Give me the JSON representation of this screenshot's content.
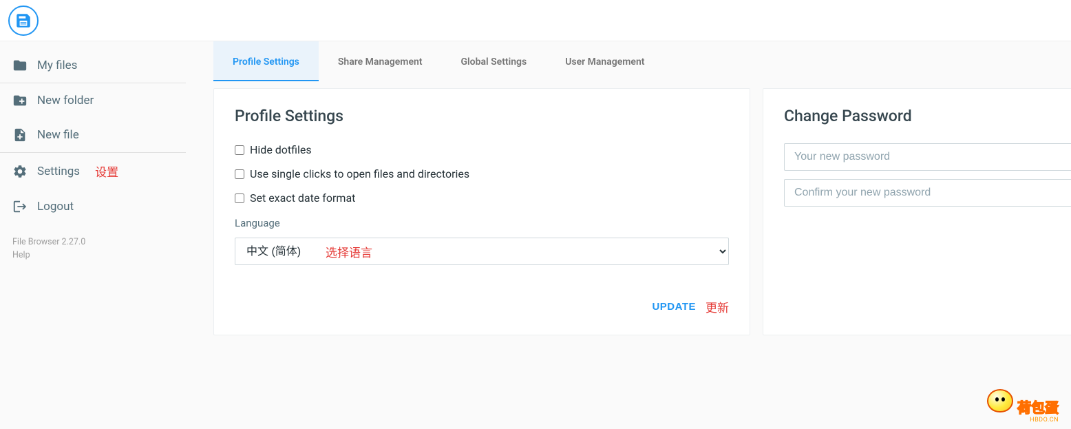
{
  "sidebar": {
    "items": [
      {
        "label": "My files"
      },
      {
        "label": "New folder"
      },
      {
        "label": "New file"
      },
      {
        "label": "Settings",
        "annotation": "设置"
      },
      {
        "label": "Logout"
      }
    ],
    "footer_version": "File Browser 2.27.0",
    "footer_help": "Help"
  },
  "tabs": [
    {
      "label": "Profile Settings",
      "active": true
    },
    {
      "label": "Share Management",
      "active": false
    },
    {
      "label": "Global Settings",
      "active": false
    },
    {
      "label": "User Management",
      "active": false
    }
  ],
  "profile": {
    "title": "Profile Settings",
    "check_hide_dotfiles": "Hide dotfiles",
    "check_single_click": "Use single clicks to open files and directories",
    "check_exact_date": "Set exact date format",
    "language_label": "Language",
    "language_value": "中文 (简体)",
    "language_annotation": "选择语言",
    "update_label": "UPDATE",
    "update_annotation": "更新"
  },
  "password": {
    "title": "Change Password",
    "new_placeholder": "Your new password",
    "confirm_placeholder": "Confirm your new password"
  },
  "watermark": {
    "main": "荷包蛋",
    "sub": "HBDO.CN"
  }
}
